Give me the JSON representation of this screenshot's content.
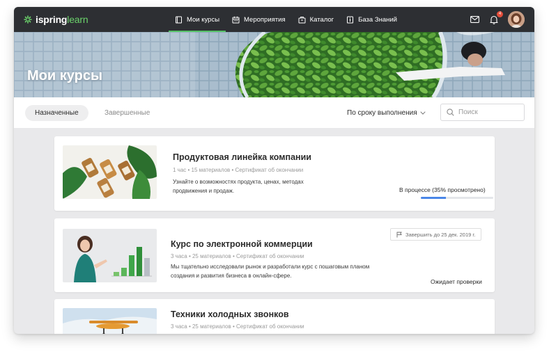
{
  "app": {
    "logo_brand": "ispring",
    "logo_suffix": "learn"
  },
  "nav": {
    "items": [
      {
        "label": "Мои курсы",
        "icon": "book-icon",
        "active": true
      },
      {
        "label": "Мероприятия",
        "icon": "calendar-icon",
        "active": false
      },
      {
        "label": "Каталог",
        "icon": "catalog-box-icon",
        "active": false
      },
      {
        "label": "База Знаний",
        "icon": "knowledge-base-icon",
        "active": false
      }
    ]
  },
  "header": {
    "notification_count": "4",
    "mail_icon": "mail-icon",
    "bell_icon": "bell-icon"
  },
  "hero": {
    "title": "Мои курсы"
  },
  "filters": {
    "tab_assigned": "Назначенные",
    "tab_completed": "Завершенные",
    "sort_label": "По сроку выполнения",
    "search_placeholder": "Поиск"
  },
  "courses": [
    {
      "title": "Продуктовая линейка компании",
      "meta": "1 час  •  15 материалов  •  Сертификат об окончании",
      "description": "Узнайте о возможностях продукта, ценах, методах продвижения и продаж.",
      "status": "В процессе (35% просмотрено)",
      "progress": 0.35
    },
    {
      "title": "Курс по электронной коммерции",
      "meta": "3 часа  •  25 материалов  •  Сертификат об окончании",
      "description": "Мы тщательно исследовали рынок и разработали курс с пошаговым планом создания и развития бизнеса в онлайн-сфере.",
      "deadline": "Завершить до 25 дек. 2019 г.",
      "status": "Ожидает проверки"
    },
    {
      "title": "Техники холодных звонков",
      "meta": "3 часа  •  25 материалов  •  Сертификат об окончании"
    }
  ],
  "colors": {
    "topbar": "#2d2f33",
    "accent_green": "#55c266",
    "progress_blue": "#4a86e8",
    "badge_red": "#e44d3a"
  }
}
